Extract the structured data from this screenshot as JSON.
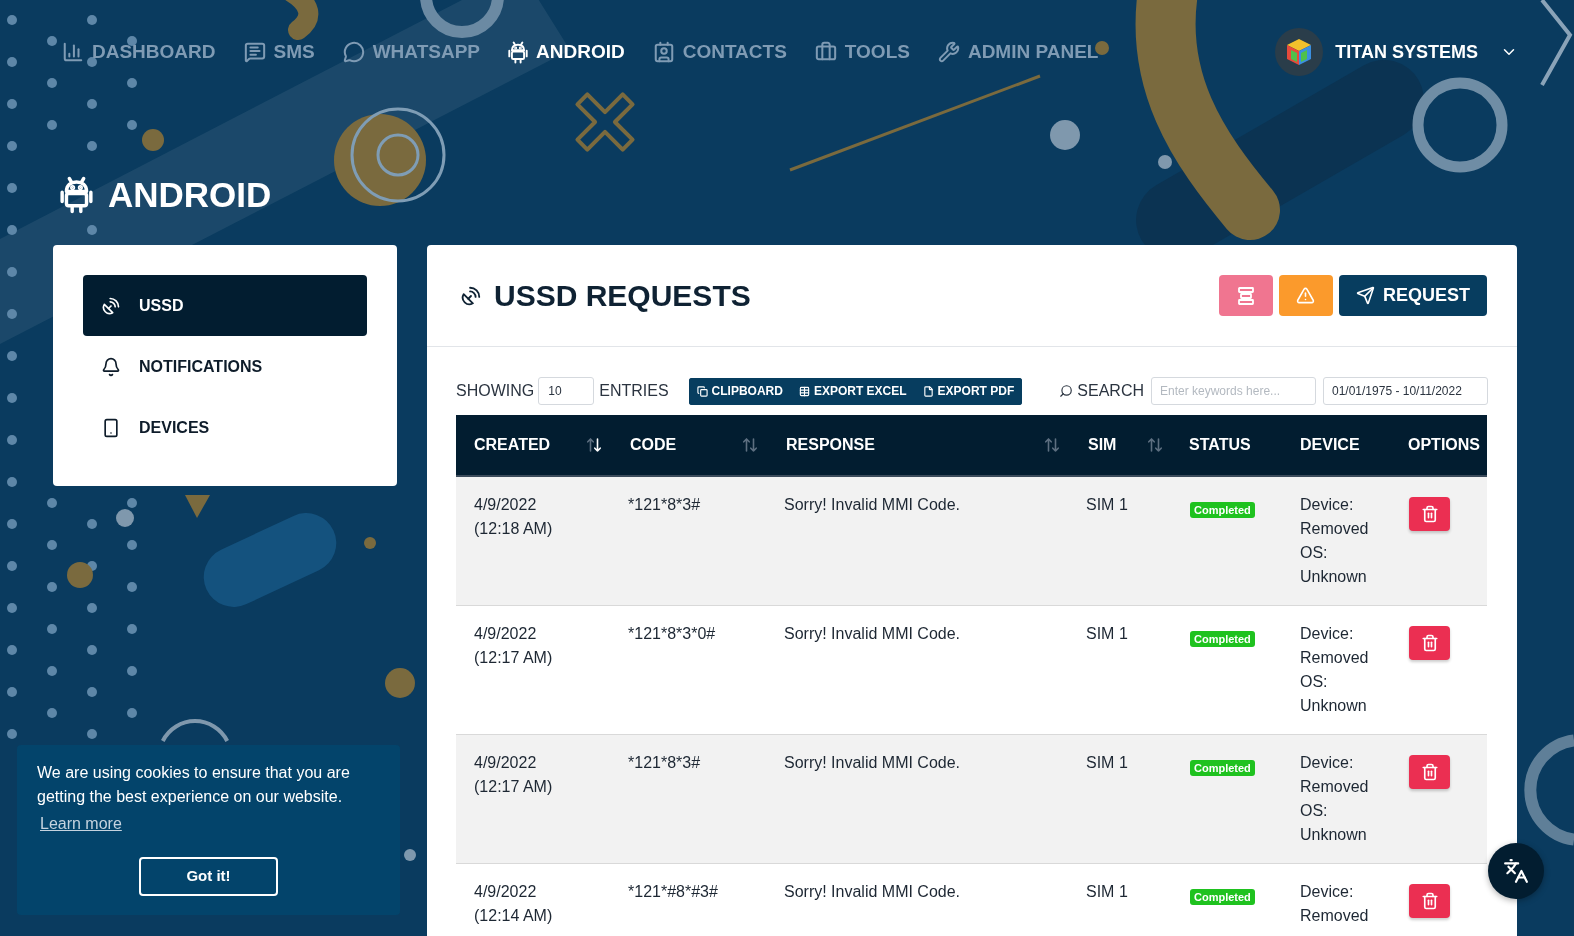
{
  "nav": {
    "items": [
      {
        "label": "DASHBOARD",
        "selected": false
      },
      {
        "label": "SMS",
        "selected": false
      },
      {
        "label": "WHATSAPP",
        "selected": false
      },
      {
        "label": "ANDROID",
        "selected": true
      },
      {
        "label": "CONTACTS",
        "selected": false
      },
      {
        "label": "TOOLS",
        "selected": false
      },
      {
        "label": "ADMIN PANEL",
        "selected": false
      }
    ],
    "account": {
      "name": "TITAN SYSTEMS"
    }
  },
  "page_title": "ANDROID",
  "sidebar": {
    "items": [
      {
        "label": "USSD",
        "selected": true
      },
      {
        "label": "NOTIFICATIONS",
        "selected": false
      },
      {
        "label": "DEVICES",
        "selected": false
      }
    ]
  },
  "panel": {
    "title": "USSD REQUESTS",
    "request_button": "REQUEST"
  },
  "toolbar": {
    "entries_prefix": "SHOWING",
    "entries_value": "10",
    "entries_suffix": "ENTRIES",
    "export_buttons": [
      "CLIPBOARD",
      "EXPORT EXCEL",
      "EXPORT PDF"
    ],
    "search_label": "SEARCH",
    "search_placeholder": "Enter keywords here...",
    "date_range": "01/01/1975 - 10/11/2022"
  },
  "table": {
    "columns": [
      {
        "label": "CREATED",
        "sortable": true,
        "sorted": true
      },
      {
        "label": "CODE",
        "sortable": true,
        "sorted": false
      },
      {
        "label": "RESPONSE",
        "sortable": true,
        "sorted": false
      },
      {
        "label": "SIM",
        "sortable": true,
        "sorted": false
      },
      {
        "label": "STATUS",
        "sortable": false
      },
      {
        "label": "DEVICE",
        "sortable": false
      },
      {
        "label": "OPTIONS",
        "sortable": false
      }
    ],
    "rows": [
      {
        "created": "4/9/2022 (12:18 AM)",
        "code": "*121*8*3#",
        "response": "Sorry! Invalid MMI Code.",
        "sim": "SIM 1",
        "status": "Completed",
        "device": "Device: Removed OS: Unknown"
      },
      {
        "created": "4/9/2022 (12:17 AM)",
        "code": "*121*8*3*0#",
        "response": "Sorry! Invalid MMI Code.",
        "sim": "SIM 1",
        "status": "Completed",
        "device": "Device: Removed OS: Unknown"
      },
      {
        "created": "4/9/2022 (12:17 AM)",
        "code": "*121*8*3#",
        "response": "Sorry! Invalid MMI Code.",
        "sim": "SIM 1",
        "status": "Completed",
        "device": "Device: Removed OS: Unknown"
      },
      {
        "created": "4/9/2022 (12:14 AM)",
        "code": "*121*#8*#3#",
        "response": "Sorry! Invalid MMI Code.",
        "sim": "SIM 1",
        "status": "Completed",
        "device": "Device: Removed"
      }
    ]
  },
  "cookie_banner": {
    "message": "We are using cookies to ensure that you are getting the best experience on our website.",
    "link": "Learn more",
    "button": "Got it!"
  }
}
